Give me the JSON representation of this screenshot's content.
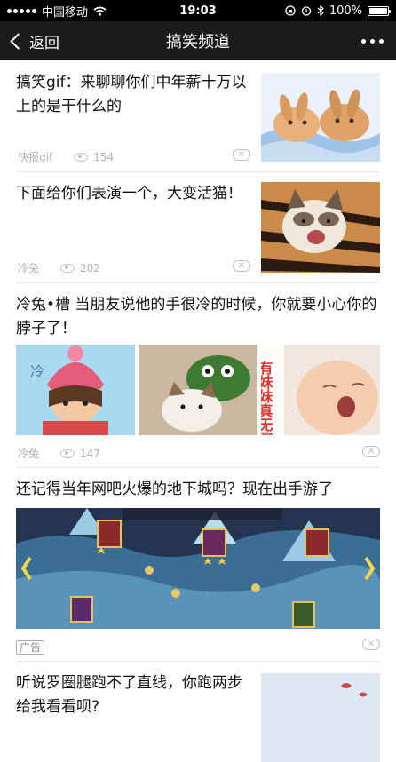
{
  "status": {
    "carrier": "中国移动",
    "time": "19:03",
    "battery": "100%",
    "battery_level": 1.0
  },
  "nav": {
    "back_label": "返回",
    "title": "搞笑频道"
  },
  "feed": [
    {
      "title": "搞笑gif：来聊聊你们中年薪十万以上的是干什么的",
      "source": "快报gif",
      "views": "154"
    },
    {
      "title": "下面给你们表演一个，大变活猫！",
      "source": "冷兔",
      "views": "202"
    },
    {
      "title": "冷兔•槽 当朋友说他的手很冷的时候，你就要小心你的脖子了！",
      "source": "冷兔",
      "views": "147",
      "image_caption": "有妹妹真无聊"
    },
    {
      "title": "还记得当年网吧火爆的地下城吗？现在出手游了",
      "ad_label": "广告"
    },
    {
      "title": "听说罗圈腿跑不了直线，你跑两步给我看看呗?"
    }
  ]
}
